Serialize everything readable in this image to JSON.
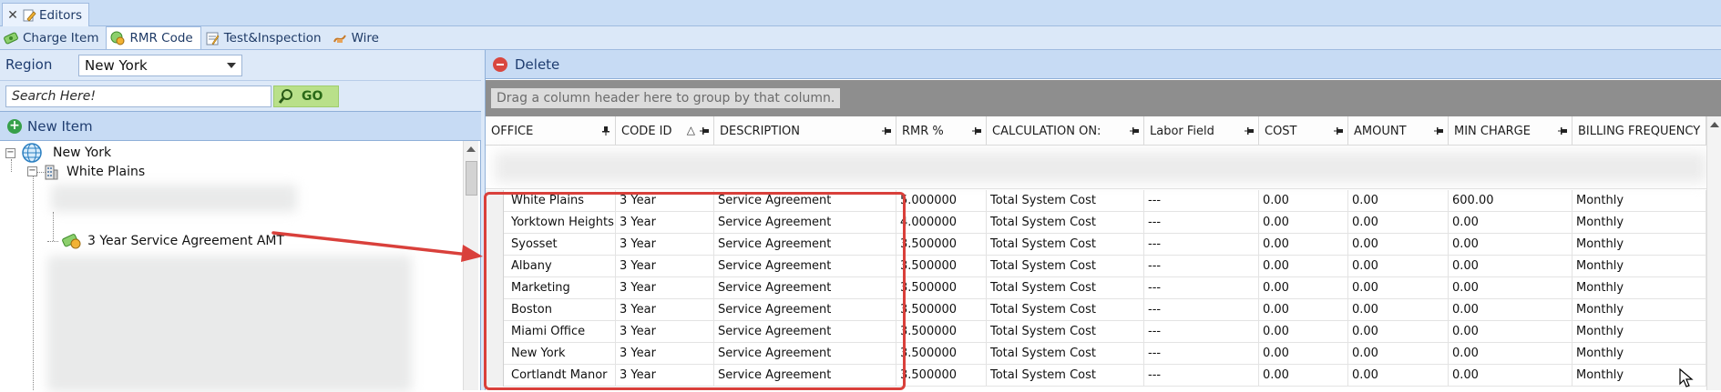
{
  "doc_tab": {
    "close": "✕",
    "label": "Editors"
  },
  "editor_tabs": [
    {
      "label": "Charge Item",
      "icon": "charge-item-icon"
    },
    {
      "label": "RMR Code",
      "icon": "rmr-code-icon"
    },
    {
      "label": "Test&Inspection",
      "icon": "test-inspection-icon"
    },
    {
      "label": "Wire",
      "icon": "wire-icon"
    }
  ],
  "left": {
    "region_label": "Region",
    "region_value": "New York",
    "search_placeholder": "Search Here!",
    "go_label": "GO",
    "new_item_label": "New Item",
    "tree": {
      "root": "New York",
      "child": "White Plains",
      "selected_item": "3 Year Service Agreement AMT",
      "expander_open": "−"
    }
  },
  "right": {
    "delete_label": "Delete",
    "group_hint": "Drag a column header here to group by that column.",
    "columns": [
      "OFFICE",
      "CODE ID",
      "DESCRIPTION",
      "RMR %",
      "CALCULATION ON:",
      "Labor Field",
      "COST",
      "AMOUNT",
      "MIN CHARGE",
      "BILLING FREQUENCY"
    ],
    "sort_indicator": "△",
    "rows": [
      [
        "White Plains",
        "3 Year",
        "Service Agreement",
        "5.000000",
        "Total System Cost",
        "---",
        "0.00",
        "0.00",
        "600.00",
        "Monthly"
      ],
      [
        "Yorktown Heights",
        "3 Year",
        "Service Agreement",
        "4.000000",
        "Total System Cost",
        "---",
        "0.00",
        "0.00",
        "0.00",
        "Monthly"
      ],
      [
        "Syosset",
        "3 Year",
        "Service Agreement",
        "3.500000",
        "Total System Cost",
        "---",
        "0.00",
        "0.00",
        "0.00",
        "Monthly"
      ],
      [
        "Albany",
        "3 Year",
        "Service Agreement",
        "3.500000",
        "Total System Cost",
        "---",
        "0.00",
        "0.00",
        "0.00",
        "Monthly"
      ],
      [
        "Marketing",
        "3 Year",
        "Service Agreement",
        "3.500000",
        "Total System Cost",
        "---",
        "0.00",
        "0.00",
        "0.00",
        "Monthly"
      ],
      [
        "Boston",
        "3 Year",
        "Service Agreement",
        "3.500000",
        "Total System Cost",
        "---",
        "0.00",
        "0.00",
        "0.00",
        "Monthly"
      ],
      [
        "Miami Office",
        "3 Year",
        "Service Agreement",
        "3.500000",
        "Total System Cost",
        "---",
        "0.00",
        "0.00",
        "0.00",
        "Monthly"
      ],
      [
        "New York",
        "3 Year",
        "Service Agreement",
        "3.500000",
        "Total System Cost",
        "---",
        "0.00",
        "0.00",
        "0.00",
        "Monthly"
      ],
      [
        "Cortlandt Manor",
        "3 Year",
        "Service Agreement",
        "3.500000",
        "Total System Cost",
        "---",
        "0.00",
        "0.00",
        "0.00",
        "Monthly"
      ]
    ]
  },
  "colors": {
    "annotation": "#d9403b",
    "panel_header": "#c7dbf4",
    "group_panel": "#8e8e8e"
  }
}
